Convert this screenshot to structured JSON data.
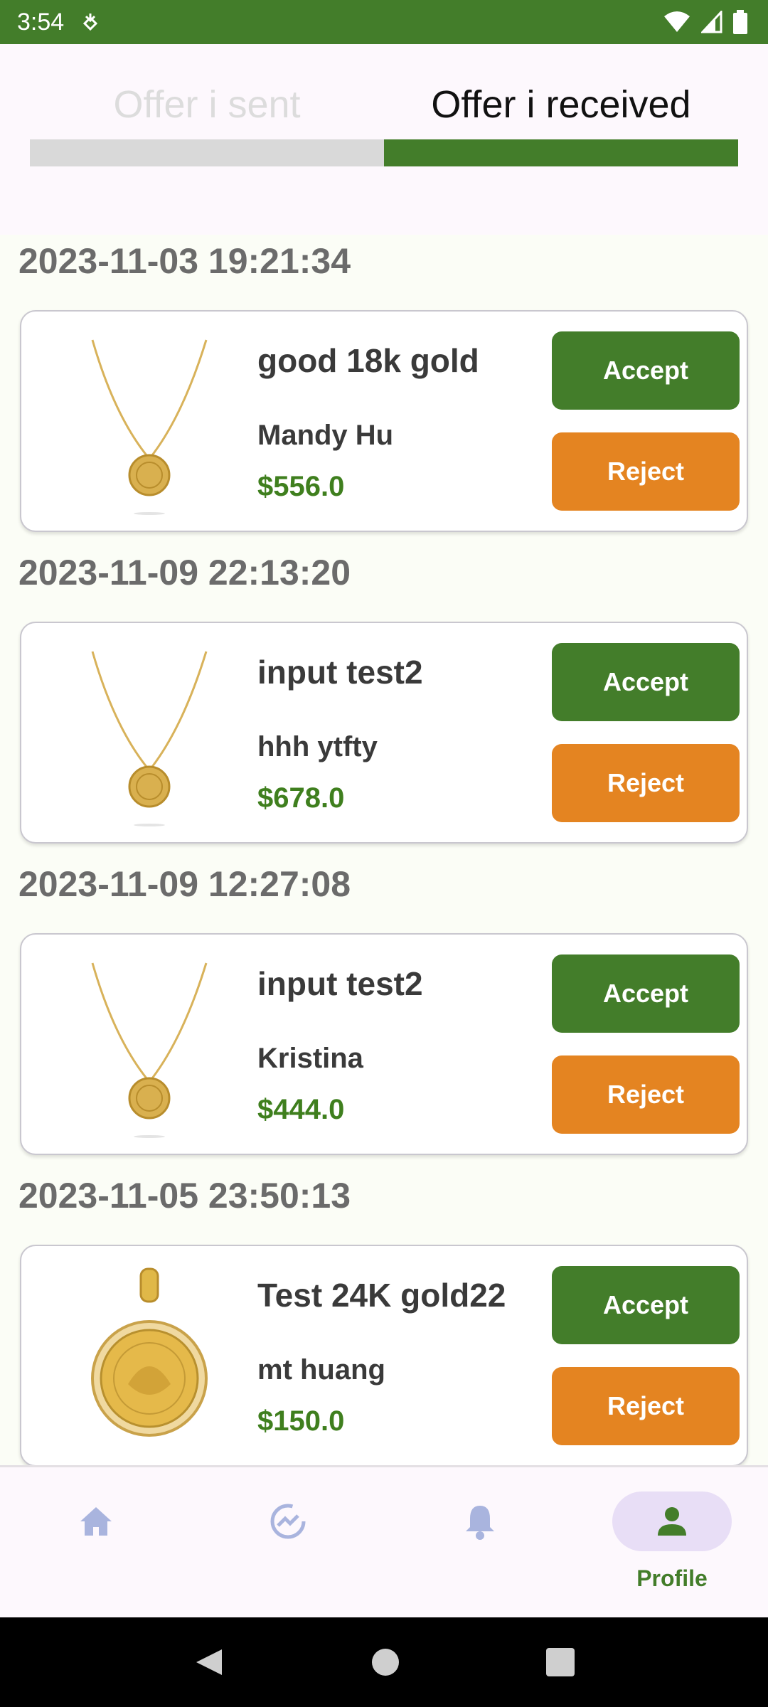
{
  "status_bar": {
    "time": "3:54"
  },
  "tabs": [
    {
      "label": "Offer i sent",
      "active": false
    },
    {
      "label": "Offer i received",
      "active": true
    }
  ],
  "offers": [
    {
      "date": "2023-11-03 19:21:34",
      "title": "good 18k gold",
      "buyer": "Mandy Hu",
      "price": "$556.0",
      "image": "gold-coin-necklace",
      "accept_label": "Accept",
      "reject_label": "Reject"
    },
    {
      "date": "2023-11-09 22:13:20",
      "title": "input test2",
      "buyer": "hhh ytfty",
      "price": "$678.0",
      "image": "gold-coin-necklace",
      "accept_label": "Accept",
      "reject_label": "Reject"
    },
    {
      "date": "2023-11-09 12:27:08",
      "title": "input test2",
      "buyer": "Kristina",
      "price": "$444.0",
      "image": "gold-coin-necklace",
      "accept_label": "Accept",
      "reject_label": "Reject"
    },
    {
      "date": "2023-11-05 23:50:13",
      "title": "Test 24K gold22",
      "buyer": "mt huang",
      "price": "$150.0",
      "image": "gold-medallion-pendant",
      "accept_label": "Accept",
      "reject_label": "Reject"
    }
  ],
  "bottom_nav": {
    "items": [
      {
        "icon": "home-icon",
        "label": "",
        "active": false
      },
      {
        "icon": "trending-icon",
        "label": "",
        "active": false
      },
      {
        "icon": "bell-icon",
        "label": "",
        "active": false
      },
      {
        "icon": "profile-icon",
        "label": "Profile",
        "active": true
      }
    ]
  },
  "colors": {
    "brand_green": "#437d2a",
    "reject_orange": "#e48421",
    "price_green": "#3f7f1e"
  }
}
